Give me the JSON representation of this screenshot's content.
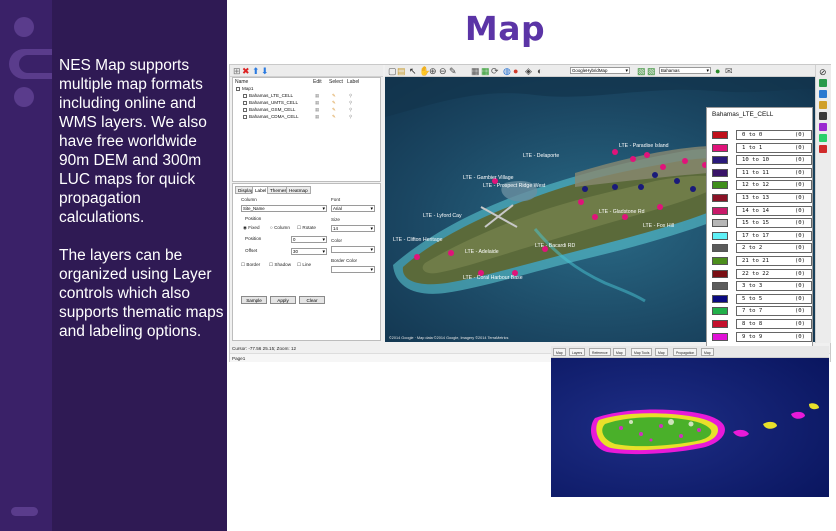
{
  "slide": {
    "title": "Map",
    "paragraph1": "NES Map supports multiple map formats including online and WMS layers. We also have free worldwide 90m DEM and 300m LUC maps for quick propagation calculations.",
    "paragraph2": "The layers can be organized using Layer controls which also supports thematic maps and labeling options."
  },
  "colors": {
    "accent": "#5b34a6",
    "rail": "#3a2168",
    "text_panel": "#2f1a54"
  },
  "app": {
    "layers": {
      "headers": [
        "Name",
        "Edit",
        "Select",
        "Label"
      ],
      "root": "Map1",
      "items": [
        "Bahamas_LTE_CELL",
        "Bahamas_UMTS_CELL",
        "Bahamas_GSM_CELL",
        "Bahamas_CDMA_CELL"
      ]
    },
    "props": {
      "tabs": [
        "Display",
        "Label",
        "Themes",
        "Heatmap"
      ],
      "column_label": "Column",
      "column_value": "Site_Name",
      "font_label": "Font",
      "font_value": "Arial",
      "size_label": "Size",
      "size_value": "14",
      "position_label": "Position",
      "fixed_label": "Fixed",
      "column_radio_label": "Column",
      "rotate_label": "Rotate",
      "position_field_label": "Position",
      "position_value": "0",
      "offset_label": "Offset",
      "offset_value": "30",
      "color_label": "Color",
      "border_color_label": "Border Color",
      "border_label": "Border",
      "shadow_label": "Shadow",
      "line_label": "Line",
      "buttons": [
        "Sample",
        "Apply",
        "Clear"
      ]
    },
    "map_toolbar": {
      "basemap": "GoogleHybridMap",
      "region": "Bahamas"
    },
    "map_labels": [
      "LTE - Delaporte",
      "LTE - Gambier Village",
      "LTE - Prospect Ridge West",
      "LTE - Lyford Cay",
      "LTE - Clifton Heritage",
      "LTE - Adelaide",
      "LTE - Coral Harbour Base",
      "LTE - Bacardi RD",
      "LTE - Paradise Island",
      "LTE - Gladstone Rd",
      "LTE - Fox Hill"
    ],
    "attribution": "©2014 Google · Map data ©2014 Google, Imagery ©2014 TerraMetrics",
    "status": "Cursor: -77.56 25.15; Zoom: 12",
    "page_label": "Page1"
  },
  "legend": {
    "title": "Bahamas_LTE_CELL",
    "items": [
      {
        "color": "#c0101a",
        "range": "0 to 0",
        "count": "(0)"
      },
      {
        "color": "#e0137a",
        "range": "1 to 1",
        "count": "(0)"
      },
      {
        "color": "#2a1a7a",
        "range": "10 to 10",
        "count": "(0)"
      },
      {
        "color": "#3a1468",
        "range": "11 to 11",
        "count": "(0)"
      },
      {
        "color": "#3f8f1a",
        "range": "12 to 12",
        "count": "(0)"
      },
      {
        "color": "#8a1226",
        "range": "13 to 13",
        "count": "(0)"
      },
      {
        "color": "#c81a6a",
        "range": "14 to 14",
        "count": "(0)"
      },
      {
        "color": "#b6b6b6",
        "range": "15 to 15",
        "count": "(0)"
      },
      {
        "color": "#5ef0f6",
        "range": "17 to 17",
        "count": "(0)"
      },
      {
        "color": "#5a5a5a",
        "range": "2 to 2",
        "count": "(0)"
      },
      {
        "color": "#4c8e1c",
        "range": "21 to 21",
        "count": "(0)"
      },
      {
        "color": "#7a0e14",
        "range": "22 to 22",
        "count": "(0)"
      },
      {
        "color": "#5c5c5c",
        "range": "3 to 3",
        "count": "(0)"
      },
      {
        "color": "#0a0a80",
        "range": "5 to 5",
        "count": "(0)"
      },
      {
        "color": "#22b04a",
        "range": "7 to 7",
        "count": "(0)"
      },
      {
        "color": "#c4102c",
        "range": "8 to 8",
        "count": "(0)"
      },
      {
        "color": "#e012d6",
        "range": "9 to 9",
        "count": "(0)"
      }
    ]
  },
  "inset": {
    "tabs": [
      "Map",
      "Layers",
      "Reference",
      "Map",
      "Map Tools",
      "Map",
      "Propagation",
      "Map"
    ]
  }
}
